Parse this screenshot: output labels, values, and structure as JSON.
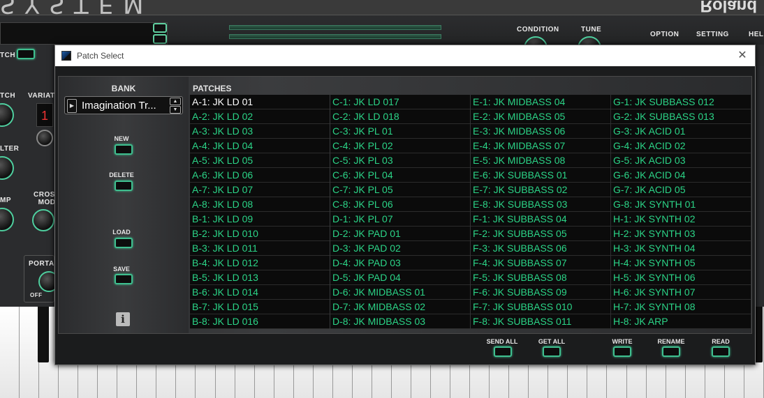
{
  "background": {
    "logo_text": "SYSTEM",
    "brand": "Roland",
    "top_labels": {
      "condition": "CONDITION",
      "tune": "TUNE",
      "option": "OPTION",
      "setting": "SETTING",
      "help": "HELP"
    },
    "left_labels": {
      "patch": "TCH",
      "pitch": "TCH",
      "variation": "VARIATI",
      "filter": "LTER",
      "amp": "MP",
      "cross_mod": "CROSS\nMOD",
      "portamento": "PORTAM",
      "off": "OFF",
      "variation_digit": "1"
    }
  },
  "dialog": {
    "title": "Patch Select",
    "close_glyph": "✕",
    "bank_header": "BANK",
    "patches_header": "PATCHES",
    "bank_name": "Imagination Tr...",
    "side_buttons": {
      "new": "NEW",
      "delete": "DELETE",
      "load": "LOAD",
      "save": "SAVE"
    },
    "info_glyph": "i",
    "patches": [
      "A-1: JK LD 01",
      "A-2: JK LD 02",
      "A-3: JK LD 03",
      "A-4: JK LD 04",
      "A-5: JK LD 05",
      "A-6: JK LD 06",
      "A-7: JK LD 07",
      "A-8: JK LD 08",
      "B-1: JK LD 09",
      "B-2: JK LD 010",
      "B-3: JK LD 011",
      "B-4: JK LD 012",
      "B-5: JK LD 013",
      "B-6: JK LD 014",
      "B-7: JK LD 015",
      "B-8: JK LD 016",
      "C-1: JK LD 017",
      "C-2: JK LD 018",
      "C-3: JK PL 01",
      "C-4: JK PL 02",
      "C-5: JK PL 03",
      "C-6: JK PL 04",
      "C-7: JK PL 05",
      "C-8: JK PL 06",
      "D-1: JK PL 07",
      "D-2: JK PAD 01",
      "D-3: JK PAD 02",
      "D-4: JK PAD 03",
      "D-5: JK PAD 04",
      "D-6: JK MIDBASS 01",
      "D-7: JK MIDBASS 02",
      "D-8: JK MIDBASS 03",
      "E-1: JK MIDBASS 04",
      "E-2: JK MIDBASS 05",
      "E-3: JK MIDBASS 06",
      "E-4: JK MIDBASS 07",
      "E-5: JK MIDBASS 08",
      "E-6: JK SUBBASS 01",
      "E-7: JK SUBBASS 02",
      "E-8: JK SUBBASS 03",
      "F-1: JK SUBBASS 04",
      "F-2: JK SUBBASS 05",
      "F-3: JK SUBBASS 06",
      "F-4: JK SUBBASS 07",
      "F-5: JK SUBBASS 08",
      "F-6: JK SUBBASS 09",
      "F-7: JK SUBBASS 010",
      "F-8: JK SUBBASS 011",
      "G-1: JK SUBBASS 012",
      "G-2: JK SUBBASS 013",
      "G-3: JK ACID 01",
      "G-4: JK ACID 02",
      "G-5: JK ACID 03",
      "G-6: JK ACID 04",
      "G-7: JK ACID 05",
      "G-8: JK SYNTH 01",
      "H-1: JK SYNTH 02",
      "H-2: JK SYNTH 03",
      "H-3: JK SYNTH 04",
      "H-4: JK SYNTH 05",
      "H-5: JK SYNTH 06",
      "H-6: JK SYNTH 07",
      "H-7: JK SYNTH 08",
      "H-8: JK ARP"
    ],
    "selected_patch": "A-1: JK LD 01",
    "bottom_buttons": {
      "send_all": "SEND ALL",
      "get_all": "GET ALL",
      "write": "WRITE",
      "rename": "RENAME",
      "read": "READ"
    }
  },
  "colors": {
    "patch_text": "#2bd487",
    "selected_text": "#ffffff",
    "accent": "#3fbf8f"
  }
}
